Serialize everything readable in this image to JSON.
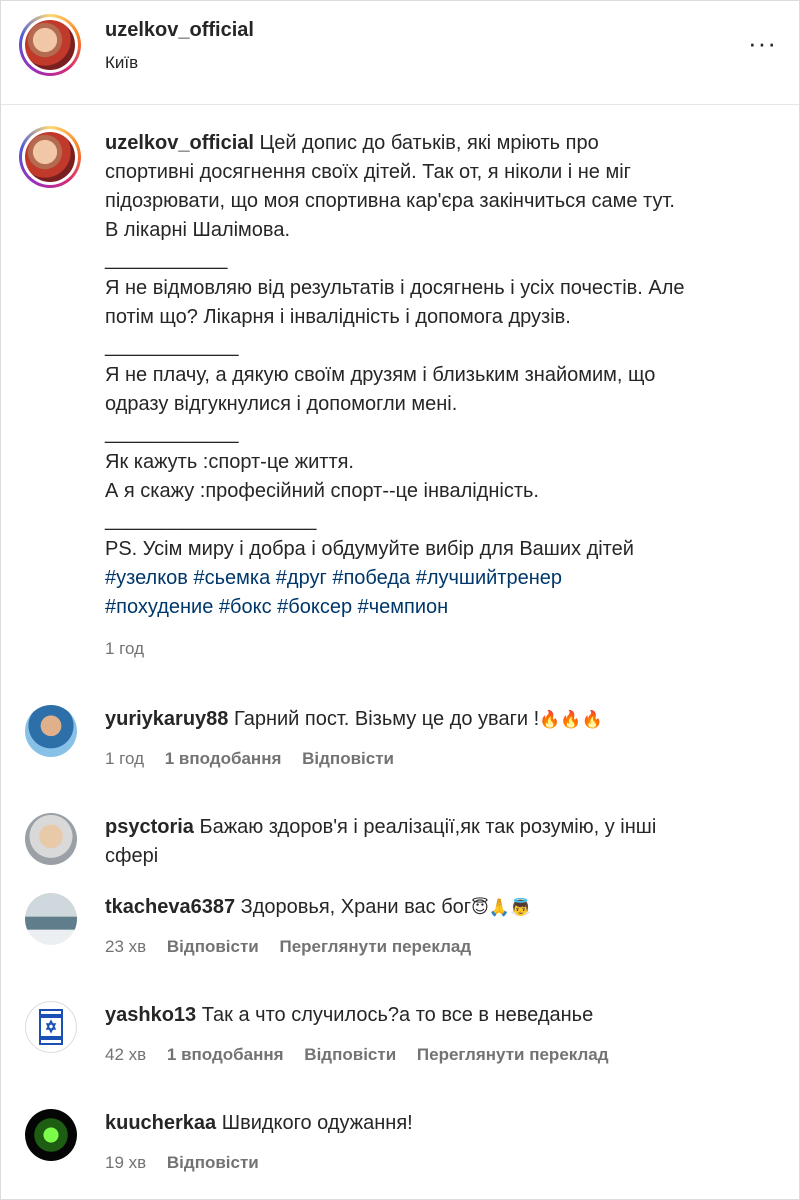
{
  "header": {
    "username": "uzelkov_official",
    "location": "Київ",
    "more_icon": "more-horizontal-icon"
  },
  "caption": {
    "username": "uzelkov_official",
    "lines": [
      "Цей допис до батьків, які мріють про",
      "спортивні досягнення своїх дітей. Так от, я ніколи і не міг",
      "підозрювати, що моя спортивна кар'єра закінчиться саме тут.",
      "В лікарні Шалімова.",
      "___________",
      "Я не відмовляю від результатів і досягнень і усіх почестів. Але",
      "потім що? Лікарня і інвалідність і допомога друзів.",
      "____________",
      "Я не плачу, а дякую своїм друзям і близьким знайомим, що",
      "одразу відгукнулися і допомогли мені.",
      "____________",
      "Як кажуть :спорт-це життя.",
      "А я скажу :професійний спорт--це інвалідність.",
      "___________________",
      "PS. Усім миру і добра і обдумуйте вибір для Ваших дітей"
    ],
    "hashtags": [
      "#узелков",
      "#сьемка",
      "#друг",
      "#победа",
      "#лучшийтренер",
      "#похудение",
      "#бокс",
      "#боксер",
      "#чемпион"
    ],
    "time": "1 год"
  },
  "comments": [
    {
      "username": "yuriykaruy88",
      "text": "Гарний пост. Візьму це до уваги !",
      "emoji": "🔥🔥🔥",
      "time": "1 год",
      "likes": "1 вподобання",
      "reply": "Відповісти",
      "translate": ""
    },
    {
      "username": "psyctoria",
      "text": "Бажаю здоров'я і реалізації,як так розумію, у інші",
      "text2": "сфері",
      "emoji": "",
      "time": "",
      "likes": "",
      "reply": "",
      "translate": ""
    },
    {
      "username": "tkacheva6387",
      "text": "Здоровья, Храни вас бог",
      "emoji": "😇🙏👼",
      "time": "23 хв",
      "likes": "",
      "reply": "Відповісти",
      "translate": "Переглянути переклад"
    },
    {
      "username": "yashko13",
      "text": "Так а что случилось?а то все в неведанье",
      "emoji": "",
      "time": "42 хв",
      "likes": "1 вподобання",
      "reply": "Відповісти",
      "translate": "Переглянути переклад"
    },
    {
      "username": "kuucherkaa",
      "text": "Швидкого одужання!",
      "emoji": "",
      "time": "19 хв",
      "likes": "",
      "reply": "Відповісти",
      "translate": ""
    }
  ],
  "colors": {
    "hashtag": "#00376b",
    "muted": "#737373",
    "text": "#262626"
  }
}
